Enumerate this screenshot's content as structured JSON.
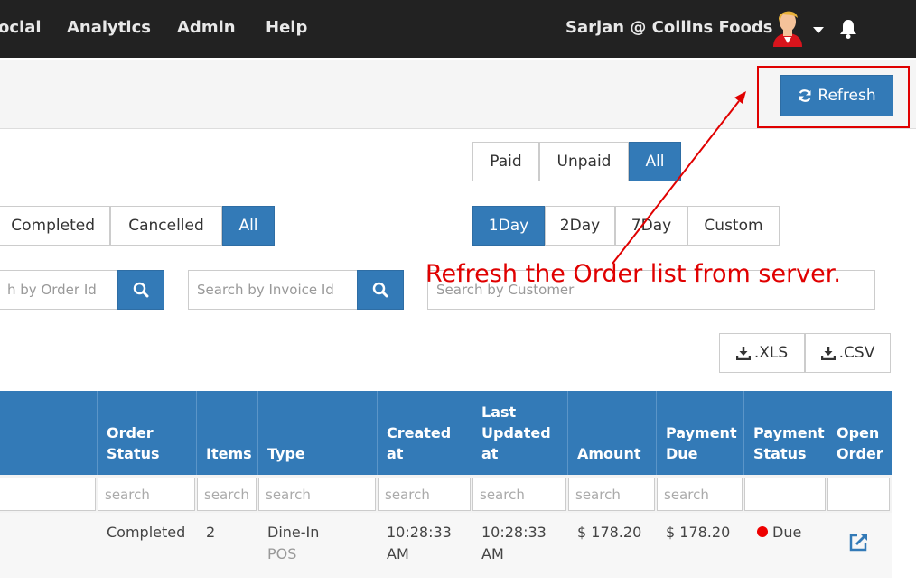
{
  "navbar": {
    "items": [
      "ocial",
      "Analytics",
      "Admin",
      "Help"
    ],
    "user": "Sarjan @ Collins Foods"
  },
  "toolbar": {
    "refresh_label": "Refresh"
  },
  "payment_filter": [
    "Paid",
    "Unpaid",
    "All"
  ],
  "status_filter": [
    "Completed",
    "Cancelled",
    "All"
  ],
  "day_filter": [
    "1Day",
    "2Day",
    "7Day",
    "Custom"
  ],
  "search": {
    "order_placeholder": "h by Order Id",
    "invoice_placeholder": "Search by Invoice Id",
    "customer_placeholder": "Search by Customer"
  },
  "annotation": "Refresh the Order list from server.",
  "export": {
    "xls": ".XLS",
    "csv": ".CSV"
  },
  "table": {
    "headers": [
      "Order Status",
      "Items",
      "Type",
      "Created at",
      "Last Updated at",
      "Amount",
      "Payment Due",
      "Payment Status",
      "Open Order"
    ],
    "filter_placeholder": "search",
    "row": {
      "order_status": "Completed",
      "items": "2",
      "type": "Dine-In",
      "type_source": "POS",
      "created_at": "10:28:33 AM",
      "updated_at": "10:28:33 AM",
      "amount": "$ 178.20",
      "payment_due": "$ 178.20",
      "payment_status": "Due"
    }
  },
  "colors": {
    "primary": "#337ab7",
    "navbar": "#222222",
    "annotation": "#e00000",
    "due": "#ee0000"
  }
}
